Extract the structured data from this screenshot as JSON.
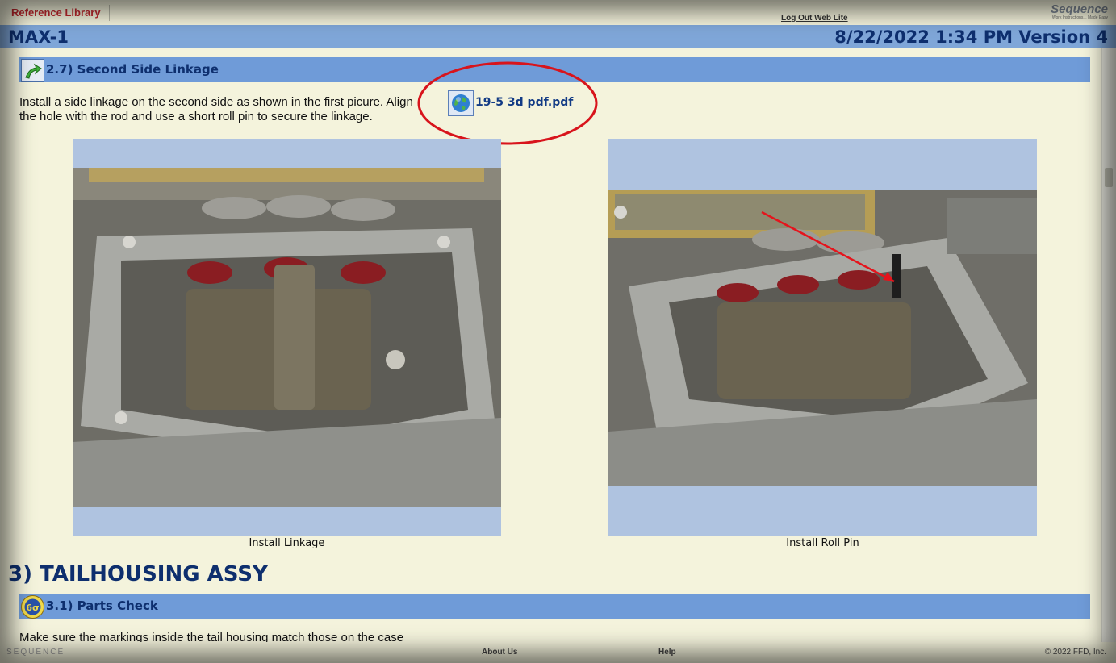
{
  "top": {
    "tab": "Reference Library",
    "logout": "Log Out Web Lite",
    "logo": "Sequence",
    "logo_tag": "Work Instructions... Made Easy"
  },
  "title": {
    "doc": "MAX-1",
    "datever": "8/22/2022 1:34 PM Version 4"
  },
  "step27": {
    "label": "2.7) Second Side Linkage",
    "text1": "Install a side linkage on the second side as shown in the first picure. Align",
    "text2": "the hole with the rod and use a short roll pin to secure the linkage.",
    "attachment": "19-5 3d pdf.pdf"
  },
  "images": [
    {
      "caption": "Install Linkage"
    },
    {
      "caption": "Install Roll Pin"
    }
  ],
  "section3": {
    "title": "3) TAILHOUSING ASSY"
  },
  "step31": {
    "label": "3.1) Parts Check",
    "text": "Make sure the markings inside the tail housing match those on the case"
  },
  "footer": {
    "brand": "SEQUENCE",
    "about": "About Us",
    "help": "Help",
    "copyright": "© 2022 FFD, Inc."
  },
  "colors": {
    "titlebar": "#7fa6d8",
    "stepbar": "#6f9bd8",
    "text_blue": "#0e2f6e",
    "annotation": "#d8141c"
  }
}
